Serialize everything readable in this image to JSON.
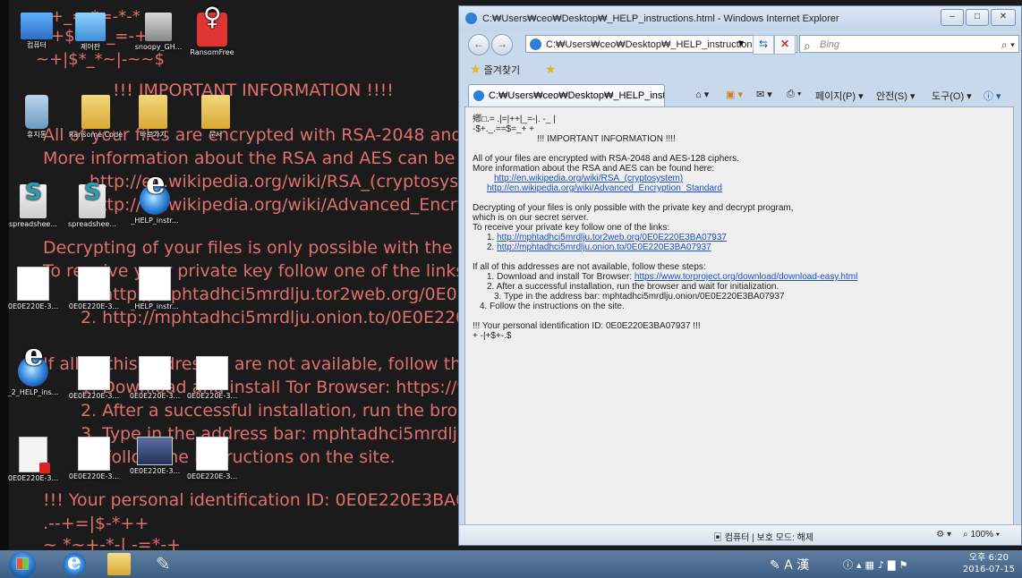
{
  "desktop": {
    "wallpaper_lines": [
      "+_=-*=-*-*",
      "*+$=   ~_=-+",
      "~+|$*_*~|-~~$",
      "!!! IMPORTANT INFORMATION !!!!",
      "All of your files are encrypted with RSA-2048 and",
      "More information about the RSA and AES can be",
      "http://en.wikipedia.org/wiki/RSA_(cryptosystem",
      "http://en.wikipedia.org/wiki/Advanced_Encryp",
      "Decrypting of your files is only possible with the p",
      "To receive your private key follow one of the links",
      "1. http://mphtadhci5mrdlju.tor2web.org/0E0E2",
      "2. http://mphtadhci5mrdlju.onion.to/0E0E220E",
      "If all of this addresses are not available, follow th",
      "1. Download and install Tor Browser: https://w",
      "2. After a successful installation, run the brows",
      "3. Type in the address bar: mphtadhci5mrdlju.",
      "4. Follow the instructions on the site.",
      "!!! Your personal identification ID: 0E0E220E3BA0",
      ".--+=|$-*++",
      "~ *~+-*-|  -=*-+"
    ],
    "icons": [
      {
        "label": "컴퓨터",
        "icon": "computer-icon"
      },
      {
        "label": "제어판",
        "icon": "control-panel-icon"
      },
      {
        "label": "snoopy_GH...",
        "icon": "disk-icon"
      },
      {
        "label": "RansomFree",
        "icon": "ransomfree-icon"
      },
      {
        "label": "휴지통",
        "icon": "recycle-bin-icon"
      },
      {
        "label": "Ransome Code",
        "icon": "folder-icon"
      },
      {
        "label": "바로가기",
        "icon": "folder-icon"
      },
      {
        "label": "문서",
        "icon": "folder-icon"
      },
      {
        "label": "spreadshee...",
        "icon": "spreadsheet-icon"
      },
      {
        "label": "spreadshee...",
        "icon": "spreadsheet-icon"
      },
      {
        "label": "_HELP_instr...",
        "icon": "ie-icon"
      },
      {
        "label": "0E0E220E-3...",
        "icon": "document-icon"
      },
      {
        "label": "0E0E220E-3...",
        "icon": "document-icon"
      },
      {
        "label": "_HELP_instr...",
        "icon": "document-icon"
      },
      {
        "label": "_2_HELP_ins...",
        "icon": "ie-icon"
      },
      {
        "label": "0E0E220E-3...",
        "icon": "document-icon"
      },
      {
        "label": "0E0E220E-3...",
        "icon": "document-icon"
      },
      {
        "label": "0E0E220E-3...",
        "icon": "document-icon"
      },
      {
        "label": "0E0E220E-3...",
        "icon": "pdf-icon"
      },
      {
        "label": "0E0E220E-3...",
        "icon": "document-icon"
      },
      {
        "label": "0E0E220E-3...",
        "icon": "image-icon"
      },
      {
        "label": "0E0E220E-3...",
        "icon": "document-icon"
      }
    ]
  },
  "ie": {
    "title": "C:₩Users₩ceo₩Desktop₩_HELP_instructions.html - Windows Internet Explorer",
    "address": "C:₩Users₩ceo₩Desktop₩_HELP_instructions",
    "search_placeholder": "Bing",
    "favorites_label": "즐겨찾기",
    "tab_label": "C:₩Users₩ceo₩Desktop₩_HELP_inst...",
    "cmd_page": "페이지(P) ▾",
    "cmd_safety": "안전(S) ▾",
    "cmd_tools": "도구(O) ▾",
    "status_zone": "컴퓨터 | 보호 모드: 해제",
    "zoom": "100%"
  },
  "page": {
    "junk1": "鄕□.= .|=|++|_=-|. -_ |",
    "junk2": "-$+._.==$=_+ +",
    "heading": "!!! IMPORTANT INFORMATION !!!!",
    "line1": "All of your files are encrypted with RSA-2048 and AES-128 ciphers.",
    "line2": "More information about the RSA and AES can be found here:",
    "link_rsa": "http://en.wikipedia.org/wiki/RSA_(cryptosystem)",
    "link_aes": "http://en.wikipedia.org/wiki/Advanced_Encryption_Standard",
    "line3": "Decrypting of your files is only possible with the private key and decrypt program,",
    "line4": "which is on our secret server.",
    "line5": "To receive your private key follow one of the links:",
    "n1": "1.",
    "link_tor2web": "http://mphtadhci5mrdlju.tor2web.org/0E0E220E3BA07937",
    "n2": "2.",
    "link_onion": "http://mphtadhci5mrdlju.onion.to/0E0E220E3BA07937",
    "line6": "If all of this addresses are not available, follow these steps:",
    "step1_text": "1. Download and install Tor Browser:",
    "link_tor": "https://www.torproject.org/download/download-easy.html",
    "step2": "2. After a successful installation, run the browser and wait for initialization.",
    "step3": "3. Type in the address bar: mphtadhci5mrdlju.onion/0E0E220E3BA07937",
    "step4": "4. Follow the instructions on the site.",
    "id_line": "!!! Your personal identification ID: 0E0E220E3BA07937 !!!",
    "junk3": "+ -|+$+-.$"
  },
  "taskbar": {
    "ime": "A 漢",
    "clock_line1": "오후 6:20",
    "clock_line2": "2016-07-15"
  }
}
